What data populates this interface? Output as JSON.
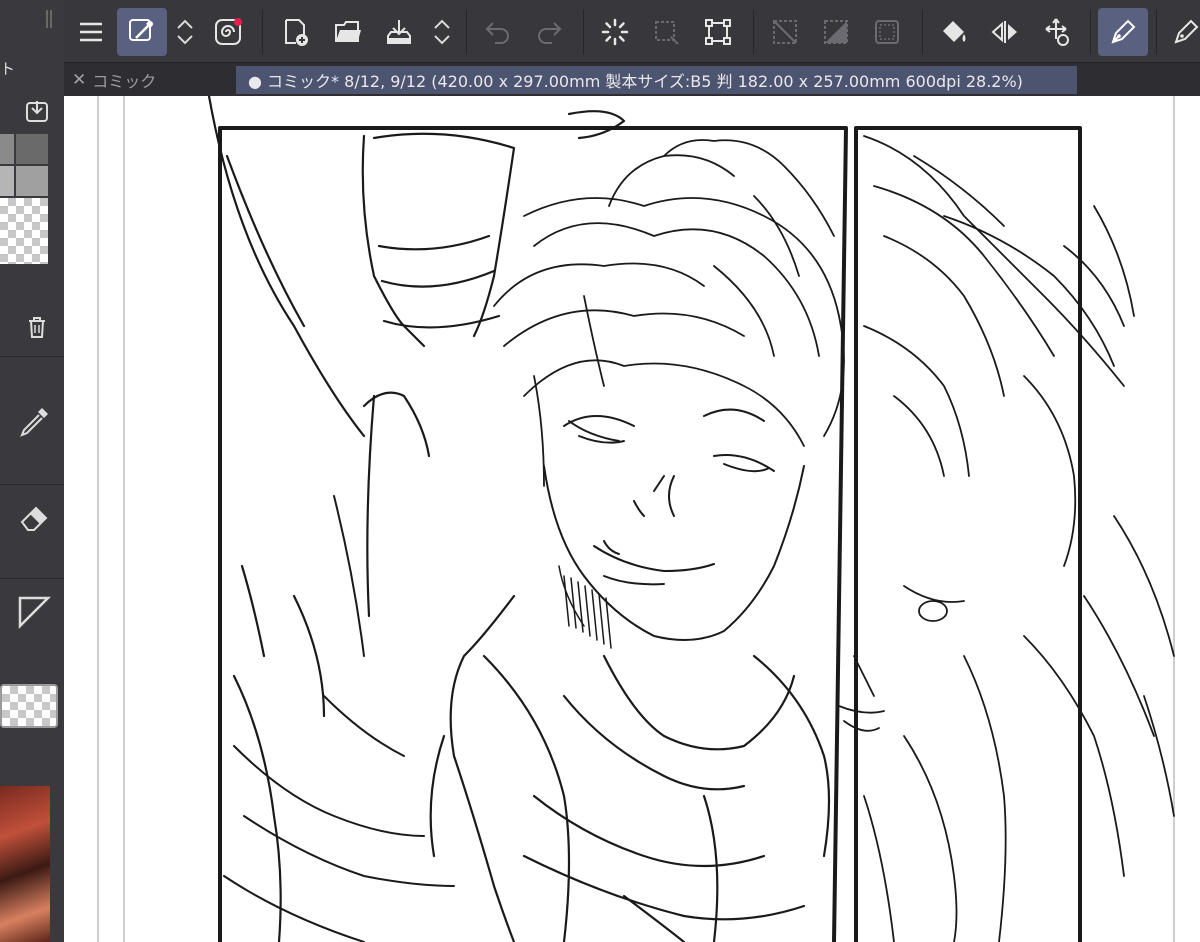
{
  "left_panel": {
    "header_label": "ト"
  },
  "toolbar": {
    "buttons": [
      {
        "id": "menu",
        "icon": "hamburger-menu-icon"
      },
      {
        "id": "color",
        "icon": "eyedropper-color-icon",
        "active": true
      },
      {
        "id": "updown1",
        "icon": "chevron-updown-icon"
      },
      {
        "id": "quickaccess",
        "icon": "spiral-icon"
      },
      {
        "id": "newpage",
        "icon": "new-page-icon"
      },
      {
        "id": "open",
        "icon": "folder-open-icon"
      },
      {
        "id": "save",
        "icon": "save-download-icon"
      },
      {
        "id": "updown2",
        "icon": "chevron-updown-icon"
      },
      {
        "id": "undo",
        "icon": "undo-icon"
      },
      {
        "id": "redo",
        "icon": "redo-icon"
      },
      {
        "id": "loading",
        "icon": "spinner-icon"
      },
      {
        "id": "selection",
        "icon": "selection-dashed-icon"
      },
      {
        "id": "transform",
        "icon": "transform-box-icon"
      },
      {
        "id": "clear",
        "icon": "clear-selection-icon"
      },
      {
        "id": "fill",
        "icon": "fill-selection-icon"
      },
      {
        "id": "frame",
        "icon": "frame-icon"
      },
      {
        "id": "paintbucket",
        "icon": "paint-bucket-icon"
      },
      {
        "id": "flip",
        "icon": "flip-horizontal-icon"
      },
      {
        "id": "move",
        "icon": "move-rotate-icon"
      },
      {
        "id": "pen",
        "icon": "pen-icon",
        "active": true
      },
      {
        "id": "pen2",
        "icon": "pen-nib-icon"
      }
    ]
  },
  "tabs": {
    "inactive_label": "コミック",
    "active_label": "● コミック* 8/12, 9/12 (420.00 x 297.00mm 製本サイズ:B5 判 182.00 x 257.00mm 600dpi 28.2%)"
  },
  "colors": {
    "toolbar_bg": "#38383c",
    "active_button": "#5a6180",
    "active_tab": "#4d5470",
    "canvas": "#ffffff",
    "record_dot": "#e0204a"
  }
}
